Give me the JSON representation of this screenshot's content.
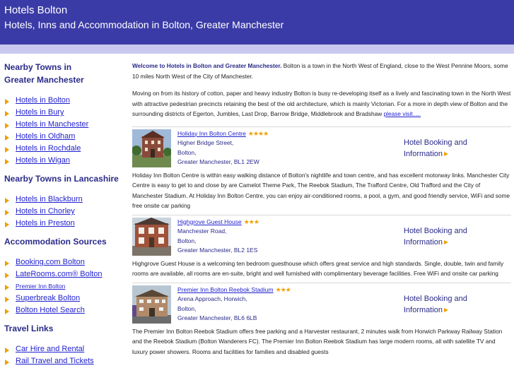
{
  "header": {
    "title": "Hotels Bolton",
    "tagline": "Hotels, Inns and Accommodation in Bolton, Greater Manchester"
  },
  "sidebar": {
    "sections": [
      {
        "heading": "Nearby Towns in Greater Manchester",
        "links": [
          "Hotels in Bolton",
          "Hotels in Bury",
          "Hotels in Manchester",
          "Hotels in Oldham",
          "Hotels in Rochdale",
          "Hotels in Wigan"
        ]
      },
      {
        "heading": "Nearby Towns in Lancashire",
        "links": [
          "Hotels in Blackburn",
          "Hotels in Chorley",
          "Hotels in Preston"
        ]
      },
      {
        "heading": "Accommodation Sources",
        "links": [
          "Booking.com Bolton",
          "LateRooms.com® Bolton",
          "Premier Inn Bolton",
          "Superbreak Bolton",
          "Bolton Hotel Search"
        ]
      },
      {
        "heading": "Travel Links",
        "links": [
          "Car Hire and Rental",
          "Rail Travel and Tickets"
        ]
      }
    ]
  },
  "intro": {
    "welcome": "Welcome to Hotels in Bolton and Greater Manchester.",
    "p1_rest": " Bolton is a town in the North West of England, close to the West Pennine Moors, some 10 miles North West of the City of Manchester.",
    "p2": "Moving on from its history of cotton, paper and heavy industry Bolton is busy re-developing itself as a lively and fascinating town in the North West with attractive pedestrian precincts retaining the best of the old architecture, which is mainly Victorian. For a more in depth view of Bolton and the surrounding districts of Egerton, Jumbles, Last Drop, Barrow Bridge, Middlebrook and Bradshaw ",
    "p2_link": "please visit....."
  },
  "hotels": [
    {
      "name": "Holiday Inn Bolton Centre",
      "stars": "★★★★",
      "address": [
        "Higher Bridge Street,",
        "Bolton,",
        "Greater Manchester, BL1 2EW"
      ],
      "booking_line1": "Hotel Booking and",
      "booking_line2": "Information",
      "description": "Holiday Inn Bolton Centre is within easy walking distance of Bolton's nightlife and town centre, and has excellent motorway links. Manchester City Centre is easy to get to and close by are Camelot Theme Park, The Reebok Stadium, The Trafford Centre, Old Trafford and the City of Manchester Stadium. At Holiday Inn Bolton Centre, you can enjoy air-conditioned rooms, a pool, a gym, and good friendly service, WiFi and some free onsite car parking"
    },
    {
      "name": "Highgrove Guest House",
      "stars": "★★★",
      "address": [
        "Manchester Road,",
        "Bolton,",
        "Greater Manchester, BL2 1ES"
      ],
      "booking_line1": "Hotel Booking and",
      "booking_line2": "Information",
      "description": "Highgrove Guest House is a welcoming ten bedroom guesthouse which offers great service and high standards. Single, double, twin and family rooms are available, all rooms are en-suite, bright and well furnished with complimentary beverage facilities. Free WiFi and onsite car parking"
    },
    {
      "name": "Premier Inn Bolton Reebok Stadium",
      "stars": "★★★",
      "address": [
        "Arena Approach, Horwich,",
        "Bolton,",
        "Greater Manchester, BL6 6LB"
      ],
      "booking_line1": "Hotel Booking and",
      "booking_line2": "Information",
      "description": "The Premier Inn Bolton Reebok Stadium offers free parking and a Harvester restaurant, 2 minutes walk from Horwich Parkway Railway Station and the Reebok Stadium (Bolton Wanderers FC). The Premier Inn Bolton Reebok Stadium has large modern rooms, all with satellite TV and luxury power showers. Rooms and facilities for families and disabled guests"
    }
  ],
  "colors": {
    "header_bg": "#3b3ba7",
    "strip_bg": "#c9c9f0",
    "heading": "#2a2a8a",
    "link": "#1f1fcf",
    "bullet": "#f0a000"
  }
}
